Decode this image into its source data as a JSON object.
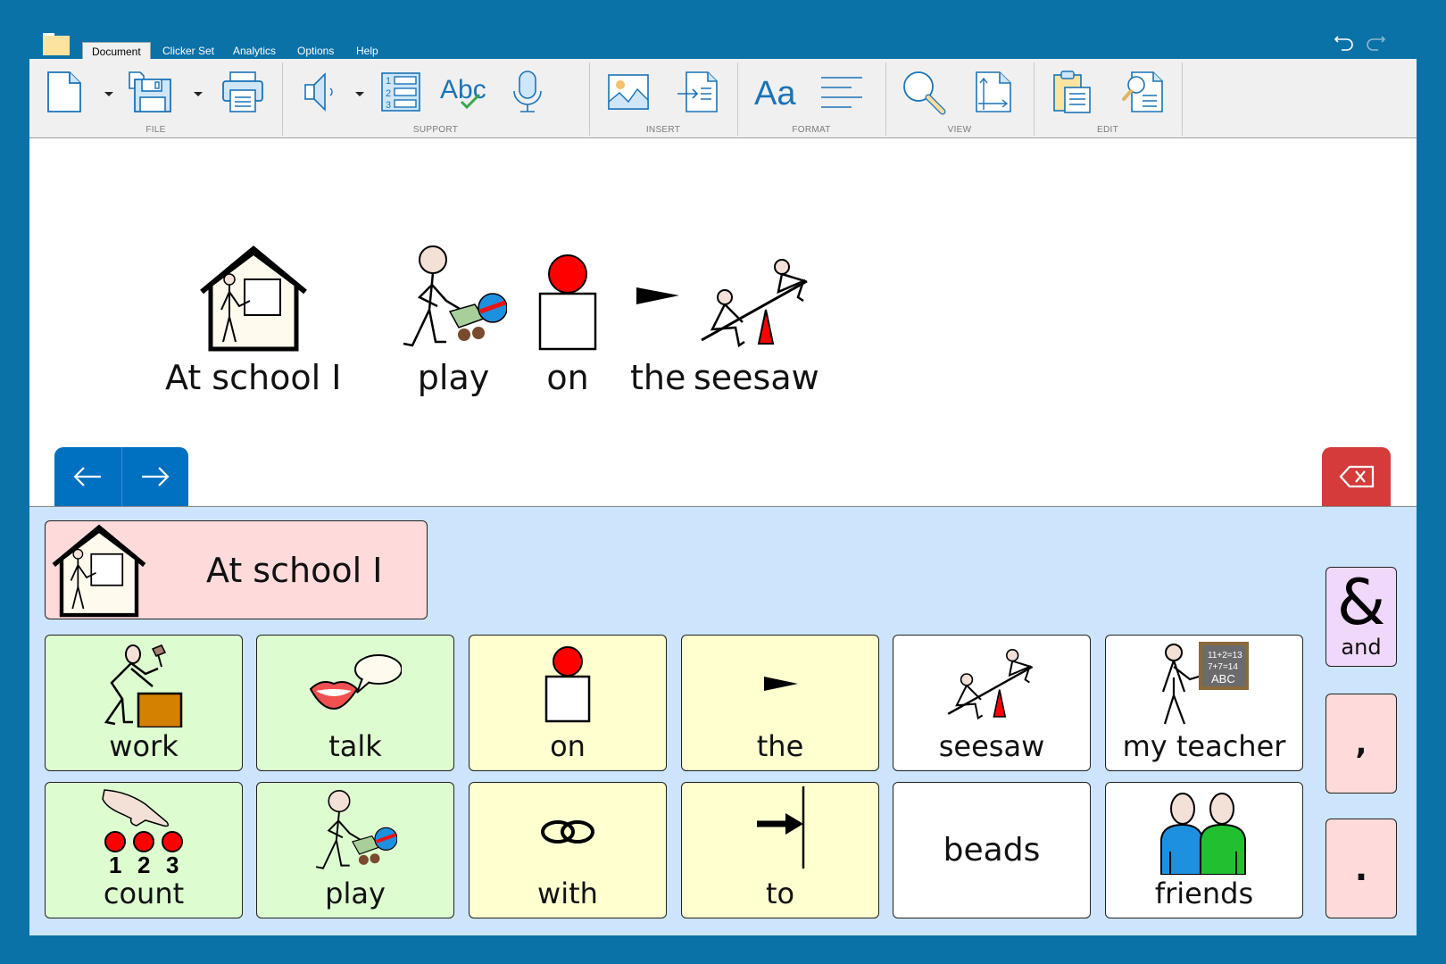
{
  "window": {
    "menu_tabs": [
      {
        "label": "Document",
        "active": true
      },
      {
        "label": "Clicker Set",
        "active": false
      },
      {
        "label": "Analytics",
        "active": false
      },
      {
        "label": "Options",
        "active": false
      },
      {
        "label": "Help",
        "active": false
      }
    ],
    "undo_icon": "undo-icon",
    "redo_icon": "redo-icon"
  },
  "ribbon": {
    "groups": [
      {
        "label": "FILE",
        "buttons": [
          "new-document-icon",
          "save-icon",
          "print-icon"
        ]
      },
      {
        "label": "SUPPORT",
        "buttons": [
          "speech-icon",
          "numbered-list-icon",
          "spellcheck-icon",
          "microphone-icon"
        ]
      },
      {
        "label": "INSERT",
        "buttons": [
          "insert-picture-icon",
          "insert-file-icon"
        ]
      },
      {
        "label": "FORMAT",
        "buttons": [
          "font-icon",
          "paragraph-align-icon"
        ]
      },
      {
        "label": "VIEW",
        "buttons": [
          "zoom-icon",
          "page-size-icon"
        ]
      },
      {
        "label": "EDIT",
        "buttons": [
          "paste-icon",
          "find-icon"
        ]
      }
    ]
  },
  "document": {
    "words": [
      {
        "text": "At school I",
        "symbol": "school-symbol"
      },
      {
        "text": "play",
        "symbol": "play-symbol"
      },
      {
        "text": "on",
        "symbol": "on-symbol"
      },
      {
        "text": "the",
        "symbol": "the-symbol"
      },
      {
        "text": "seesaw",
        "symbol": "seesaw-symbol"
      }
    ],
    "nav": {
      "back_icon": "arrow-left-icon",
      "forward_icon": "arrow-right-icon"
    },
    "delete_icon": "backspace-icon"
  },
  "grid": {
    "sentence_cell": {
      "label": "At school I",
      "symbol": "school-symbol"
    },
    "rows": [
      [
        {
          "label": "work",
          "color": "green",
          "symbol": "work-symbol"
        },
        {
          "label": "talk",
          "color": "green",
          "symbol": "talk-symbol"
        },
        {
          "label": "on",
          "color": "yellow",
          "symbol": "on-symbol"
        },
        {
          "label": "the",
          "color": "yellow",
          "symbol": "the-symbol"
        },
        {
          "label": "seesaw",
          "color": "white",
          "symbol": "seesaw-symbol"
        },
        {
          "label": "my teacher",
          "color": "white",
          "symbol": "teacher-symbol"
        }
      ],
      [
        {
          "label": "count",
          "color": "green",
          "symbol": "count-symbol"
        },
        {
          "label": "play",
          "color": "green",
          "symbol": "play-symbol"
        },
        {
          "label": "with",
          "color": "yellow",
          "symbol": "with-symbol"
        },
        {
          "label": "to",
          "color": "yellow",
          "symbol": "to-symbol"
        },
        {
          "label": "beads",
          "color": "white",
          "symbol": ""
        },
        {
          "label": "friends",
          "color": "white",
          "symbol": "friends-symbol"
        }
      ]
    ],
    "side_cells": [
      {
        "label": "and",
        "glyph": "&",
        "color": "lilac"
      },
      {
        "label": ",",
        "color": "pink"
      },
      {
        "label": ".",
        "color": "pink"
      }
    ],
    "teacher_board": [
      "11+2=13",
      "7+7=14",
      "ABC"
    ],
    "count_numbers": [
      "1",
      "2",
      "3"
    ]
  },
  "colors": {
    "window_blue": "#0b72a8",
    "nav_blue": "#0070c0",
    "delete_red": "#d43b3b",
    "grid_bg": "#cce5fc",
    "cell_green": "#ddfdd0",
    "cell_yellow": "#ffffd0",
    "cell_pink": "#ffdada",
    "cell_lilac": "#f0d8fa"
  }
}
